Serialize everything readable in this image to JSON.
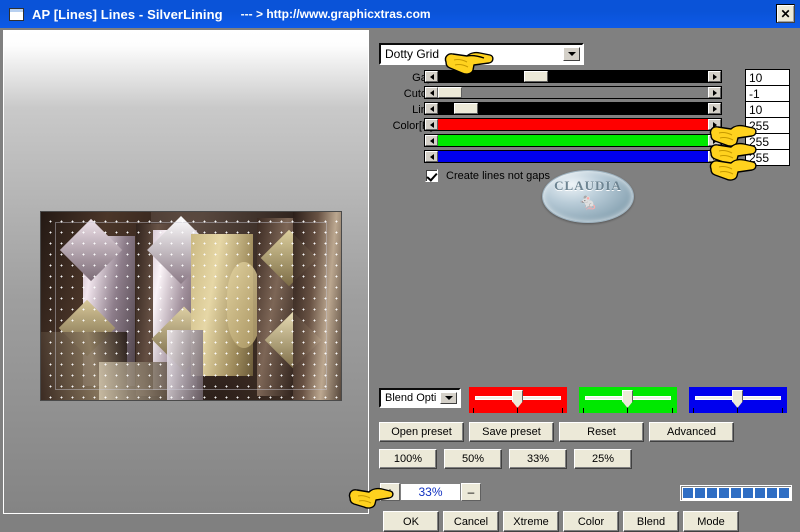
{
  "titlebar": {
    "icon": "window-icon",
    "app_title": "AP [Lines]  Lines - SilverLining",
    "url_text": "--- > http://www.graphicxtras.com",
    "close_label": "✕"
  },
  "preset": {
    "selected": "Dotty Grid",
    "options": [
      "Dotty Grid"
    ]
  },
  "sliders": [
    {
      "label": "Gap:",
      "value": "10",
      "thumb_pct": 32,
      "track_color": "#000000"
    },
    {
      "label": "Cutoff:",
      "value": "-1",
      "thumb_pct": 0,
      "track_color": "#808080"
    },
    {
      "label": "Line:",
      "value": "10",
      "thumb_pct": 6,
      "track_color": "#000000"
    }
  ],
  "color_sliders": [
    {
      "label": "Color[R]:",
      "value": "255",
      "color": "#ff0000"
    },
    {
      "label": "",
      "value": "255",
      "color": "#00e800"
    },
    {
      "label": "",
      "value": "255",
      "color": "#0000ee"
    }
  ],
  "checkbox": {
    "label": "Create lines not gaps",
    "checked": true
  },
  "watermark": {
    "text": "CLAUDIA",
    "figure": "🐁"
  },
  "blend": {
    "combo_selected": "Blend Opti",
    "trackbars": [
      {
        "name": "red-trackbar",
        "color": "#ff0000",
        "thumb_pct": 48
      },
      {
        "name": "green-trackbar",
        "color": "#00e800",
        "thumb_pct": 48
      },
      {
        "name": "blue-trackbar",
        "color": "#0000ee",
        "thumb_pct": 48
      }
    ]
  },
  "preset_buttons": [
    {
      "label": "Open preset"
    },
    {
      "label": "Save preset"
    },
    {
      "label": "Reset"
    },
    {
      "label": "Advanced"
    }
  ],
  "zoom_buttons": [
    {
      "label": "100%"
    },
    {
      "label": "50%"
    },
    {
      "label": "33%"
    },
    {
      "label": "25%"
    }
  ],
  "zoom_stepper": {
    "increase": "+",
    "value": "33%",
    "decrease": "–"
  },
  "progress": {
    "segments": 9,
    "filled": 9,
    "color": "#2f6ec4"
  },
  "action_buttons": [
    {
      "label": "OK"
    },
    {
      "label": "Cancel"
    },
    {
      "label": "Xtreme"
    },
    {
      "label": "Color"
    },
    {
      "label": "Blend"
    },
    {
      "label": "Mode"
    }
  ],
  "cursors": [
    {
      "name": "hand-cursor-preset"
    },
    {
      "name": "hand-cursor-red"
    },
    {
      "name": "hand-cursor-green"
    },
    {
      "name": "hand-cursor-blue"
    },
    {
      "name": "hand-cursor-ok"
    }
  ]
}
